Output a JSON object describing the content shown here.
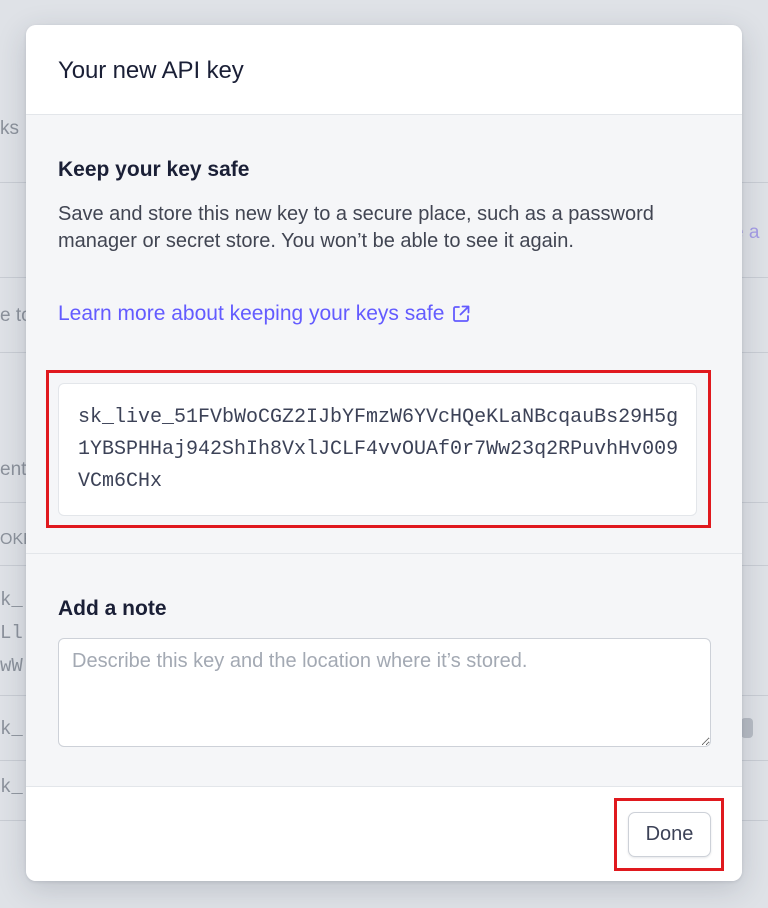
{
  "background": {
    "fragments": [
      "ks",
      "e a",
      "e to",
      "ent",
      "OKE",
      "k_",
      "Ll",
      "wW",
      "k_",
      "k_"
    ]
  },
  "modal": {
    "title": "Your new API key",
    "safety": {
      "heading": "Keep your key safe",
      "description": "Save and store this new key to a secure place, such as a password manager or secret store. You won’t be able to see it again.",
      "link_label": "Learn more about keeping your keys safe",
      "link_icon": "external-link-icon"
    },
    "api_key": "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",
    "note": {
      "heading": "Add a note",
      "placeholder": "Describe this key and the location where it’s stored.",
      "value": ""
    },
    "footer": {
      "done_label": "Done"
    }
  },
  "colors": {
    "accent": "#635bff",
    "highlight": "#e0191e"
  }
}
